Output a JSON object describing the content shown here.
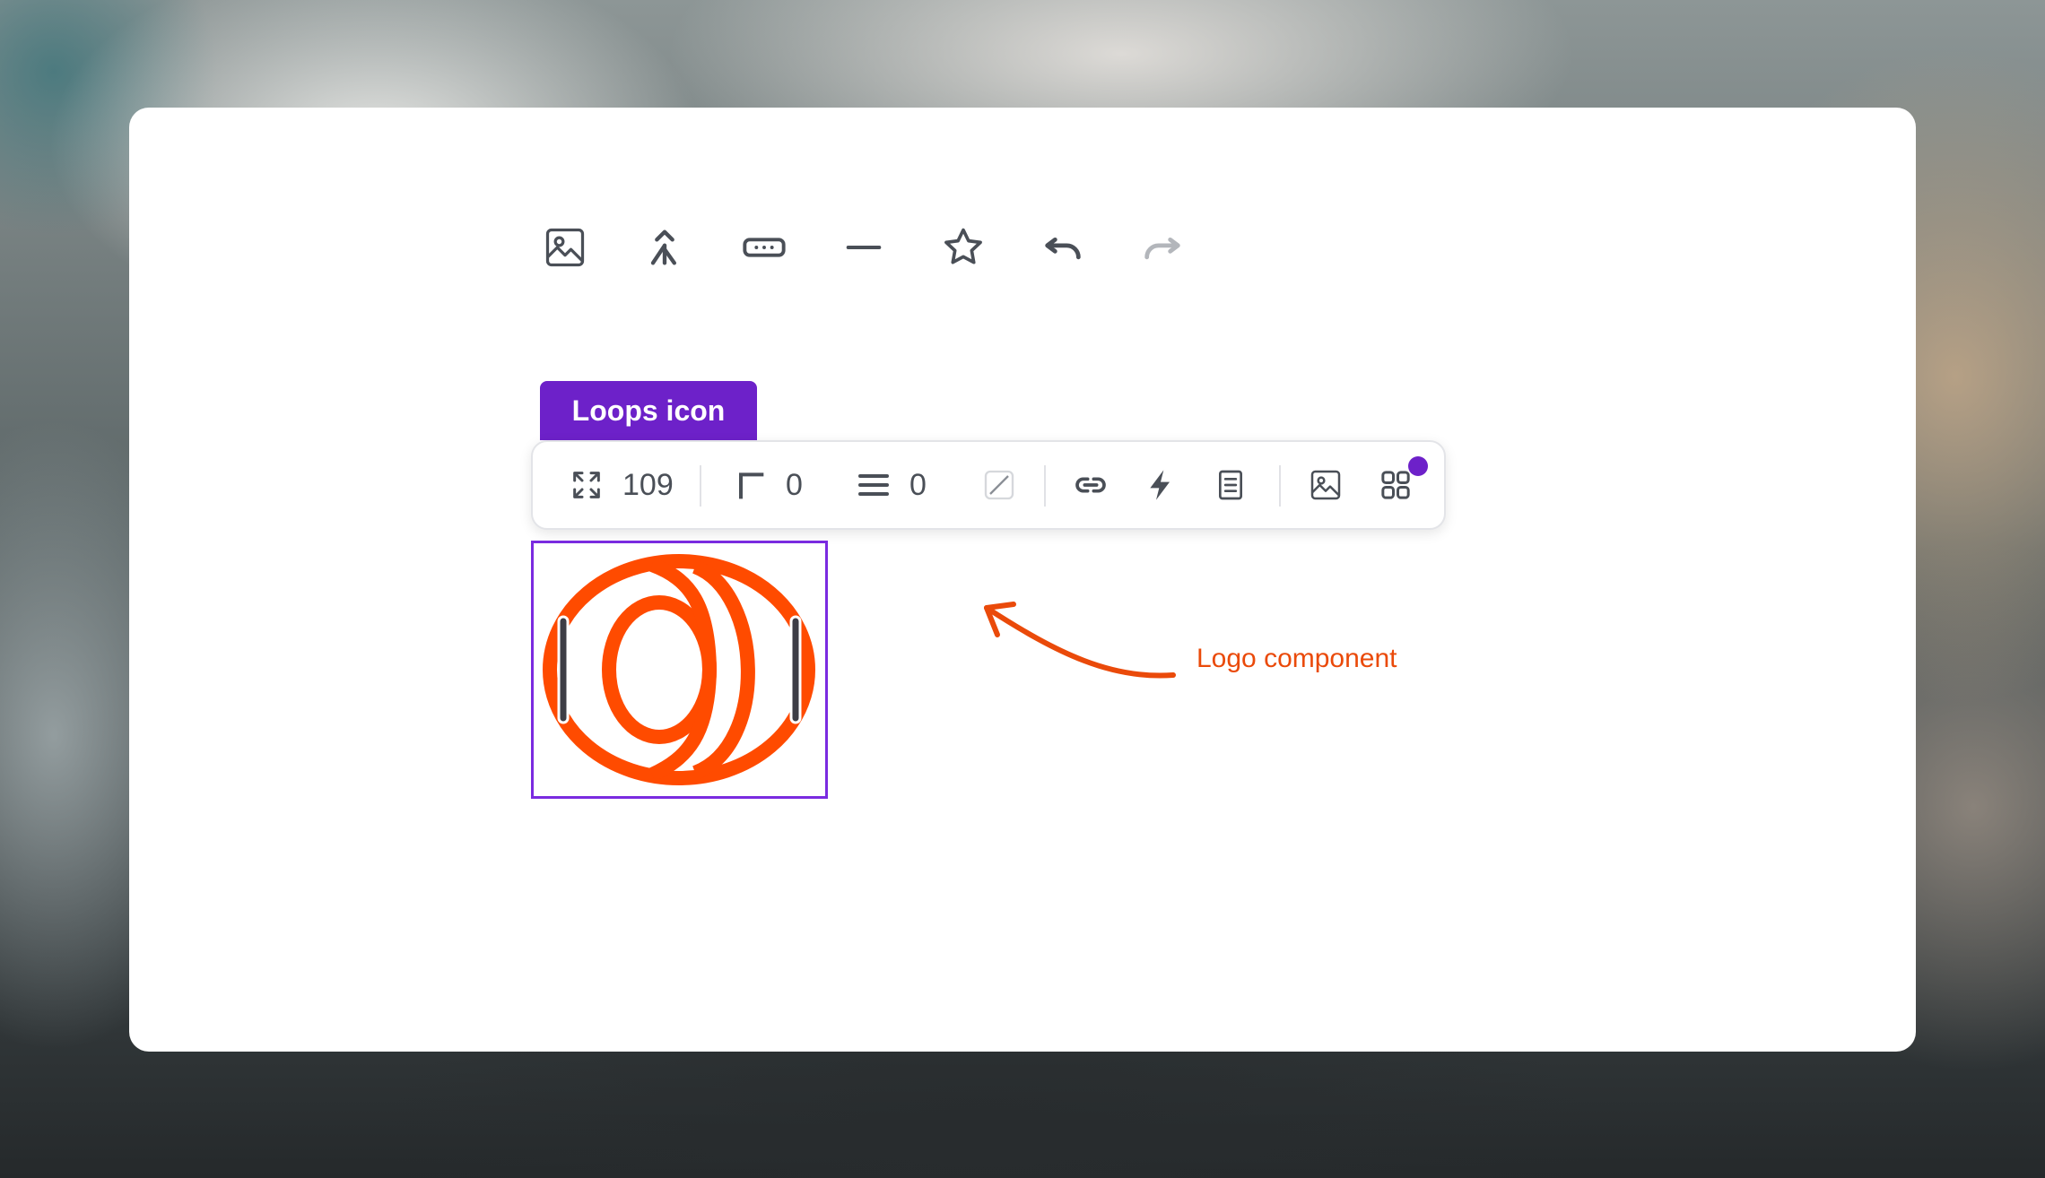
{
  "top_toolbar": {
    "items": [
      {
        "name": "image-icon"
      },
      {
        "name": "merge-icon"
      },
      {
        "name": "button-icon"
      },
      {
        "name": "divider-icon"
      },
      {
        "name": "star-icon"
      },
      {
        "name": "undo-icon"
      },
      {
        "name": "redo-icon",
        "disabled": true
      }
    ]
  },
  "selection": {
    "label": "Loops icon"
  },
  "properties": {
    "size": "109",
    "radius": "0",
    "padding": "0",
    "icons": [
      "expand-icon",
      "corner-radius-icon",
      "padding-icon",
      "no-fill-icon",
      "link-icon",
      "bolt-icon",
      "document-icon",
      "image-icon",
      "components-icon"
    ]
  },
  "annotation": {
    "text": "Logo component"
  },
  "colors": {
    "accent": "#6d21c9",
    "logo": "#ff4b00",
    "annotation": "#ea4a0a",
    "icon": "#4a4f57"
  }
}
